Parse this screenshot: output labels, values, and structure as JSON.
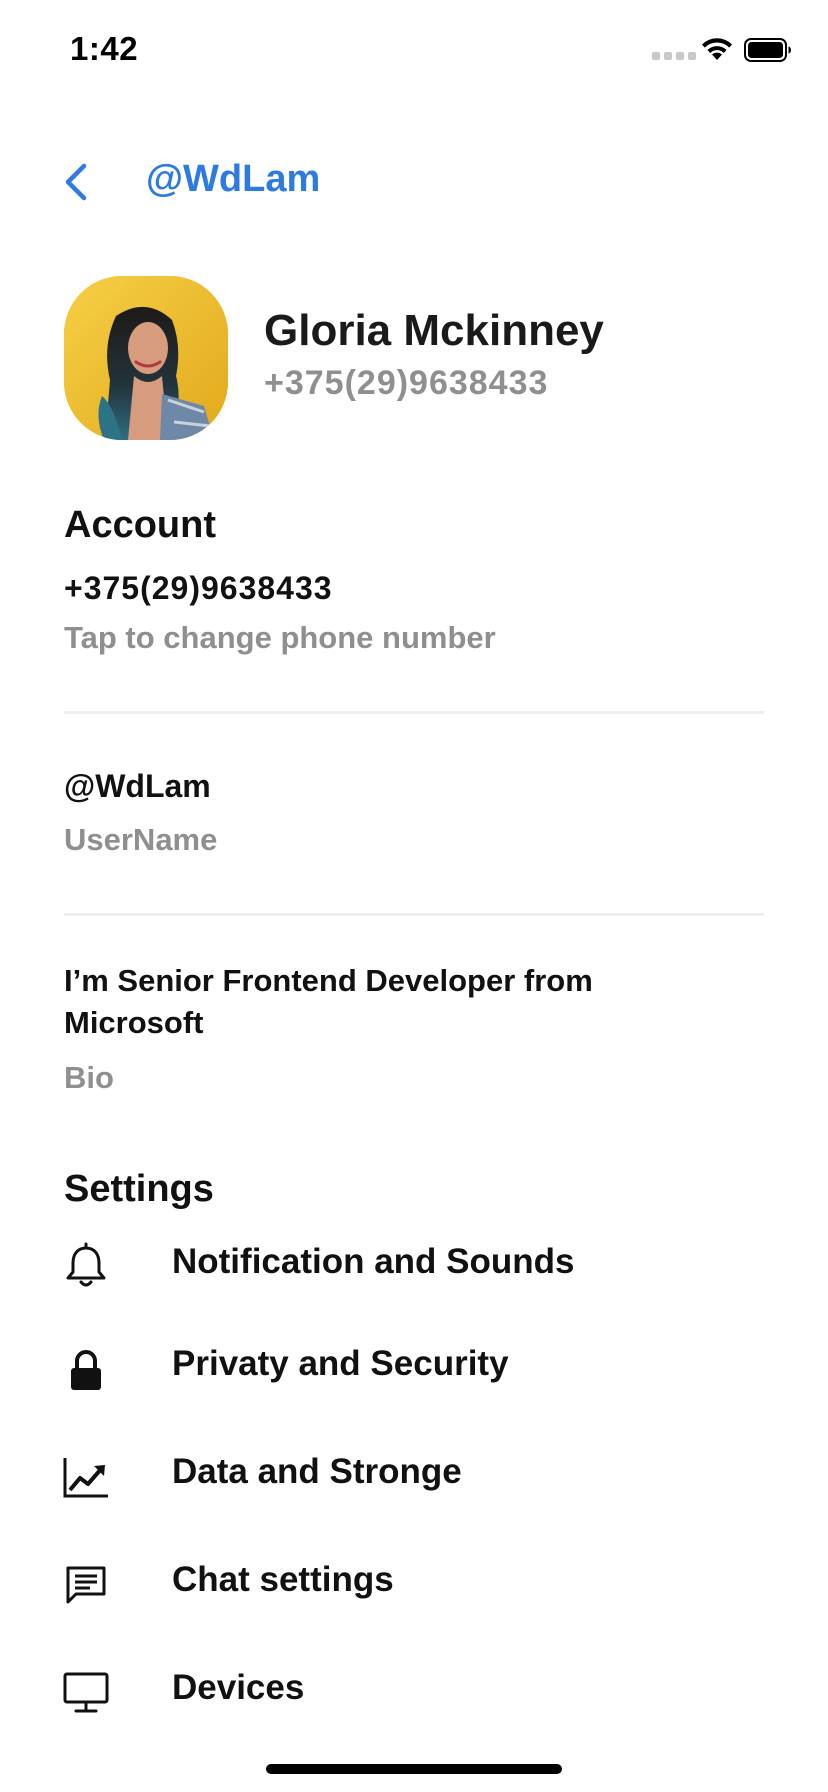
{
  "status_bar": {
    "time": "1:42"
  },
  "header": {
    "title": "@WdLam",
    "back_icon": "chevron-left-icon"
  },
  "profile": {
    "name": "Gloria Mckinney",
    "phone": "+375(29)9638433"
  },
  "account": {
    "section_title": "Account",
    "phone_value": "+375(29)9638433",
    "phone_hint": "Tap to change phone number",
    "username_value": "@WdLam",
    "username_label": "UserName",
    "bio_value": "I’m Senior Frontend Developer from Microsoft",
    "bio_label": "Bio"
  },
  "settings": {
    "section_title": "Settings",
    "items": [
      {
        "label": "Notification and Sounds",
        "icon": "bell-icon"
      },
      {
        "label": "Privaty and Security",
        "icon": "lock-icon"
      },
      {
        "label": "Data and Stronge",
        "icon": "trending-up-chart-icon"
      },
      {
        "label": "Chat settings",
        "icon": "chat-message-icon"
      },
      {
        "label": "Devices",
        "icon": "monitor-icon"
      }
    ]
  },
  "colors": {
    "accent": "#2d7ae0",
    "secondary_text": "#8f8f8f",
    "divider": "#eeeeee"
  }
}
